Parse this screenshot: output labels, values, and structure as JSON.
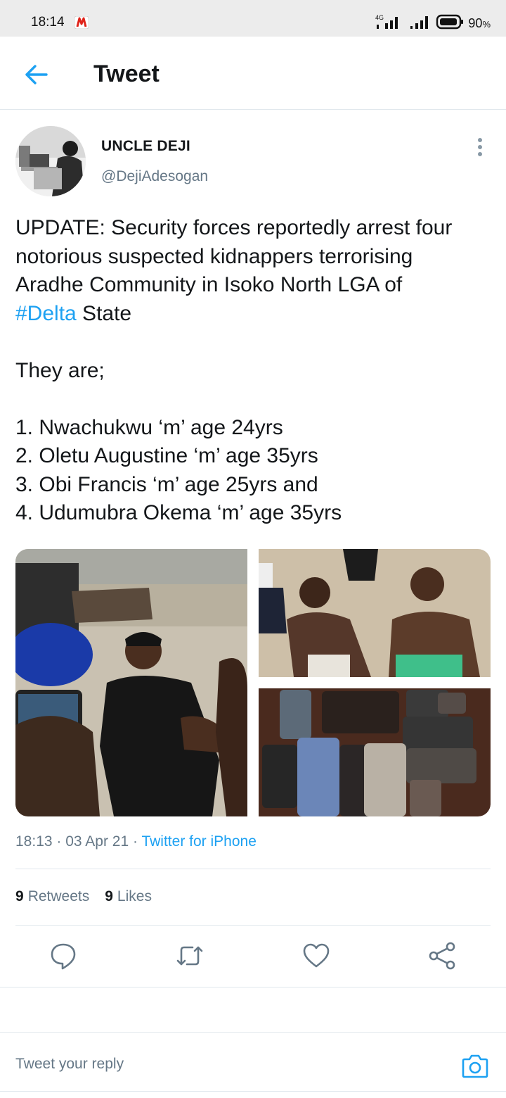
{
  "status_bar": {
    "time": "18:14",
    "network": "4G",
    "battery": "90",
    "battery_unit": "%",
    "battery_level": 0.9
  },
  "header": {
    "back_icon": "arrow-left-icon",
    "title": "Tweet"
  },
  "tweet": {
    "author": {
      "name": "UNCLE DEJI",
      "handle": "@DejiAdesogan"
    },
    "text": {
      "line1": "UPDATE: Security forces reportedly arrest four",
      "line2": "notorious suspected kidnappers terrorising",
      "line3": "Aradhe Community in Isoko North LGA of",
      "hashtag": "#Delta",
      "line4_rest": " State",
      "intro": "They are;",
      "items": [
        "1. Nwachukwu ‘m’ age 24yrs",
        "2. Oletu Augustine ‘m’ age 35yrs",
        "3. Obi Francis ‘m’ age 25yrs  and",
        "4. Udumubra Okema ‘m’ age 35yrs"
      ]
    },
    "meta": {
      "time": "18:13",
      "separator": "·",
      "date": "03 Apr 21",
      "source": "Twitter for iPhone"
    },
    "stats": {
      "retweets_count": "9",
      "retweets_label": "Retweets",
      "likes_count": "9",
      "likes_label": "Likes"
    }
  },
  "actions": {
    "reply_icon": "comment-icon",
    "retweet_icon": "retweet-icon",
    "like_icon": "heart-icon",
    "share_icon": "share-icon"
  },
  "reply": {
    "placeholder": "Tweet your reply",
    "camera_icon": "camera-icon"
  },
  "colors": {
    "accent": "#1da1f2",
    "secondary_text": "#657786",
    "primary_text": "#14171a",
    "divider": "#e1e8ed"
  }
}
